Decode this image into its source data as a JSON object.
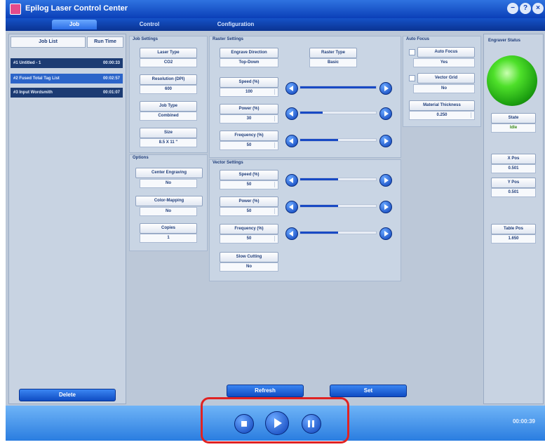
{
  "window": {
    "title": "Epilog Laser Control Center"
  },
  "tabs": [
    {
      "label": "Job"
    },
    {
      "label": "Control"
    },
    {
      "label": "Configuration"
    }
  ],
  "job_list": {
    "headers": [
      "Job List",
      "Run Time"
    ],
    "rows": [
      {
        "name": "#1 Untitled - 1",
        "time": "00:00:33"
      },
      {
        "name": "#2 Fused Total Tag List",
        "time": "00:02:57"
      },
      {
        "name": "#3 Input Wordsmith",
        "time": "00:01:07"
      }
    ],
    "delete_label": "Delete"
  },
  "job_settings": {
    "title": "Job Settings",
    "laser_type_label": "Laser Type",
    "laser_type_value": "CO2",
    "resolution_label": "Resolution (DPI)",
    "resolution_value": "600",
    "job_type_label": "Job Type",
    "job_type_value": "Combined",
    "size_label": "Size",
    "size_value": "8.5 X 11 \""
  },
  "options": {
    "title": "Options",
    "center_engraving_label": "Center Engraving",
    "center_engraving_value": "No",
    "color_mapping_label": "Color-Mapping",
    "color_mapping_value": "No",
    "copies_label": "Copies",
    "copies_value": "1"
  },
  "raster_settings": {
    "title": "Raster Settings",
    "direction_label": "Engrave Direction",
    "direction_value": "Top-Down",
    "raster_type_label": "Raster Type",
    "raster_type_value": "Basic",
    "speed_label": "Speed (%)",
    "speed_value": "100",
    "speed_level": 1.0,
    "power_label": "Power (%)",
    "power_value": "30",
    "power_level": 0.3,
    "frequency_label": "Frequency (%)",
    "frequency_value": "50",
    "frequency_level": 0.5
  },
  "vector_settings": {
    "title": "Vector Settings",
    "speed_label": "Speed (%)",
    "speed_value": "50",
    "speed_level": 0.5,
    "power_label": "Power (%)",
    "power_value": "50",
    "power_level": 0.5,
    "frequency_label": "Frequency (%)",
    "frequency_value": "50",
    "frequency_level": 0.5,
    "slow_cutting_label": "Slow Cutting",
    "slow_cutting_value": "No"
  },
  "auto_focus": {
    "title": "Auto Focus",
    "auto_focus_label": "Auto Focus",
    "auto_focus_value": "Yes",
    "vector_grid_label": "Vector Grid",
    "vector_grid_value": "No",
    "material_thickness_label": "Material Thickness",
    "material_thickness_value": "0.250"
  },
  "engraver_status": {
    "title": "Engraver Status",
    "state_label": "State",
    "state_value": "Idle",
    "xpos_label": "X Pos",
    "xpos_value": "0.501",
    "ypos_label": "Y Pos",
    "ypos_value": "0.501",
    "table_pos_label": "Table Pos",
    "table_pos_value": "1.650"
  },
  "footer": {
    "refresh_label": "Refresh",
    "set_label": "Set",
    "elapsed": "00:00:39"
  },
  "colors": {
    "accent": "#0b3fb8",
    "status_led": "#4ee02a",
    "highlight": "#e02222"
  }
}
